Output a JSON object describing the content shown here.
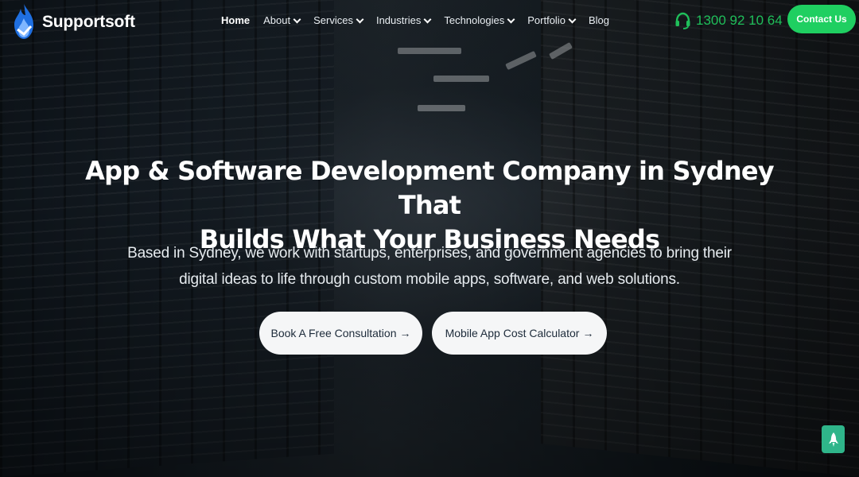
{
  "brand": {
    "name": "Supportsoft"
  },
  "nav": {
    "items": [
      {
        "label": "Home",
        "active": true,
        "has_dropdown": false
      },
      {
        "label": "About",
        "has_dropdown": true
      },
      {
        "label": "Services",
        "has_dropdown": true
      },
      {
        "label": "Industries",
        "has_dropdown": true
      },
      {
        "label": "Technologies",
        "has_dropdown": true
      },
      {
        "label": "Portfolio",
        "has_dropdown": true
      },
      {
        "label": "Blog",
        "has_dropdown": false
      }
    ]
  },
  "header": {
    "phone": "1300 92 10 64",
    "phone_icon": "headset-icon",
    "contact_label": "Contact Us"
  },
  "hero": {
    "title_line1": "App & Software Development Company in Sydney That",
    "title_line2": "Builds What Your Business Needs",
    "subtitle_line1": "Based in Sydney, we work with startups, enterprises, and government agencies to bring their",
    "subtitle_line2": "digital ideas to life through custom mobile apps, software, and web solutions.",
    "cta_primary": "Book A Free Consultation",
    "cta_secondary": "Mobile App Cost Calculator",
    "cta_arrow": "→"
  },
  "widgets": {
    "scroll_top_icon": "rocket-icon"
  },
  "colors": {
    "accent_green": "#1fcf61",
    "phone_green": "#1fbf5a",
    "logo_blue": "#1f6fe0",
    "scroll_top_bg": "#2fb58a",
    "button_bg": "#f5f6f7",
    "button_text": "#1d2b3a"
  }
}
